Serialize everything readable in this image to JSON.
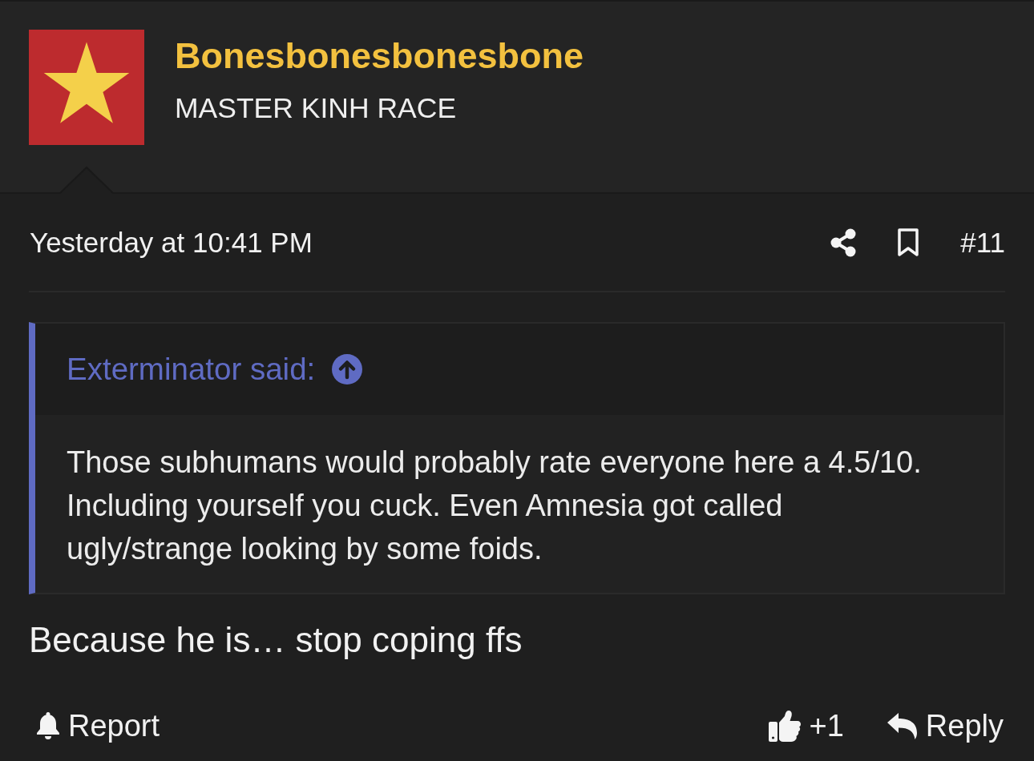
{
  "post": {
    "author": {
      "name": "Bonesbonesbonesbone",
      "title": "MASTER KINH RACE"
    },
    "timestamp": "Yesterday at 10:41 PM",
    "post_number": "#11",
    "quote": {
      "attribution": "Exterminator said:",
      "text": "Those subhumans would probably rate everyone here a 4.5/10.\nIncluding yourself you cuck. Even Amnesia got called\nugly/strange looking by some foids."
    },
    "message": "Because he is… stop coping ffs",
    "actions": [
      {
        "kind": "report",
        "label": "Report"
      },
      {
        "kind": "like",
        "label": "+1"
      },
      {
        "kind": "reply",
        "label": "Reply"
      }
    ]
  }
}
